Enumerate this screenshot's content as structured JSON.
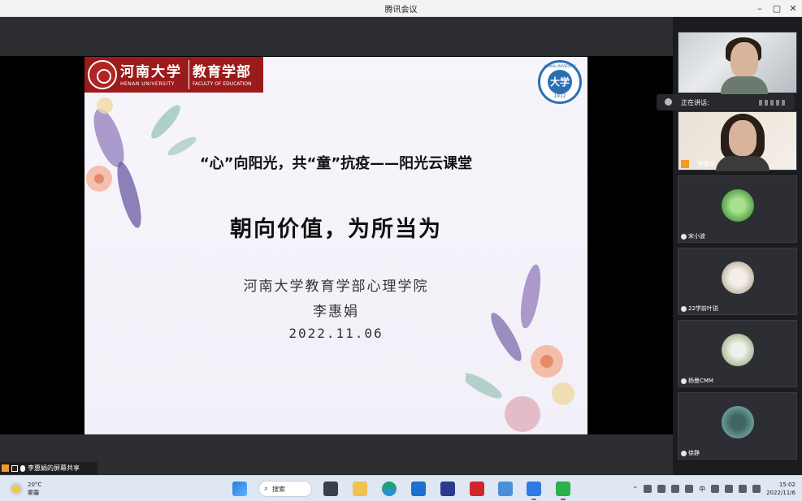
{
  "window": {
    "title": "腾讯会议",
    "minimize": "–",
    "maximize": "▢",
    "close": "✕"
  },
  "slide": {
    "logo_cn": "河南大学",
    "logo_en": "HENAN UNIVERSITY",
    "faculty_cn": "教育学部",
    "faculty_en": "FACULTY OF EDUCATION",
    "emblem_ring": "HENAN UNIVERSITY",
    "emblem_center": "大学",
    "emblem_year": "1912",
    "subtitle": "“心”向阳光，共“童”抗疫——阳光云课堂",
    "title": "朝向价值，为所当为",
    "organization": "河南大学教育学部心理学院",
    "author": "李惠娟",
    "date": "2022.11.06"
  },
  "speaking": {
    "label": "正在讲话:"
  },
  "participants": [
    {
      "name": "",
      "type": "video"
    },
    {
      "name": "李惠娟",
      "type": "video"
    },
    {
      "name": "宋小波",
      "type": "avatar",
      "color": "#7cc46a"
    },
    {
      "name": "22学前叶锐",
      "type": "avatar",
      "color": "#d8cfc2"
    },
    {
      "name": "杨曼CMM",
      "type": "avatar",
      "color": "#b9c7ad"
    },
    {
      "name": "徐静",
      "type": "avatar",
      "color": "#5c8a86"
    }
  ],
  "share": {
    "label": "李惠娟的屏幕共享"
  },
  "taskbar": {
    "weather_temp": "20°C",
    "weather_desc": "雾霾",
    "search_label": "搜索",
    "ime": "中",
    "time": "15:02",
    "date": "2022/11/6"
  },
  "colors": {
    "brand_red": "#9b1b1b",
    "emblem_blue": "#2b6fb3",
    "taskbar": "#dfe7f3"
  }
}
